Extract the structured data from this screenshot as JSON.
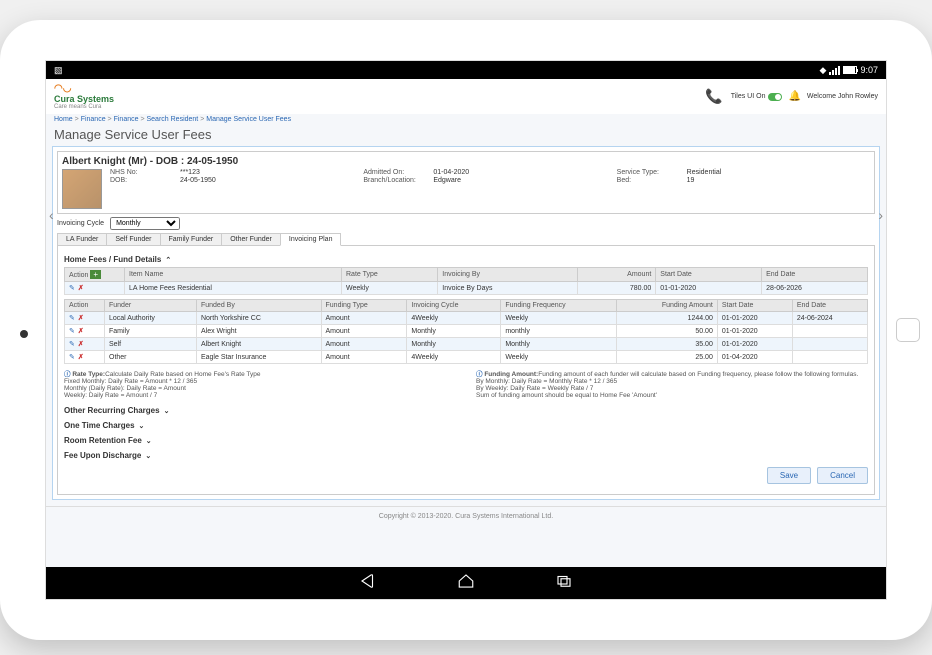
{
  "status_bar": {
    "time": "9:07"
  },
  "logo": {
    "name": "Cura Systems",
    "tagline": "Care means Cura"
  },
  "header": {
    "tiles_label": "Tiles UI On",
    "welcome": "Welcome John Rowley"
  },
  "breadcrumb": [
    "Home",
    "Finance",
    "Finance",
    "Search Resident",
    "Manage Service User Fees"
  ],
  "page_title": "Manage Service User Fees",
  "user": {
    "name_line": "Albert Knight (Mr) - DOB : 24-05-1950",
    "nhs_label": "NHS No:",
    "nhs": "***123",
    "dob_label": "DOB:",
    "dob": "24-05-1950",
    "admitted_label": "Admitted On:",
    "admitted": "01-04-2020",
    "branch_label": "Branch/Location:",
    "branch": "Edgware",
    "svc_label": "Service Type:",
    "svc": "Residential",
    "bed_label": "Bed:",
    "bed": "19"
  },
  "cycle": {
    "label": "Invoicing Cycle",
    "value": "Monthly"
  },
  "tabs": [
    "LA Funder",
    "Self Funder",
    "Family Funder",
    "Other Funder",
    "Invoicing Plan"
  ],
  "section1": "Home Fees / Fund Details",
  "table1": {
    "headers": [
      "Action",
      "Item Name",
      "Rate Type",
      "Invoicing By",
      "Amount",
      "Start Date",
      "End Date"
    ],
    "row": {
      "item": "LA Home Fees Residential",
      "rate": "Weekly",
      "inv_by": "Invoice By Days",
      "amount": "780.00",
      "start": "01-01-2020",
      "end": "28-06-2026"
    }
  },
  "table2": {
    "headers": [
      "Action",
      "Funder",
      "Funded By",
      "Funding Type",
      "Invoicing Cycle",
      "Funding Frequency",
      "Funding Amount",
      "Start Date",
      "End Date"
    ],
    "rows": [
      {
        "funder": "Local Authority",
        "by": "North Yorkshire CC",
        "type": "Amount",
        "cycle": "4Weekly",
        "freq": "Weekly",
        "amt": "1244.00",
        "start": "01-01-2020",
        "end": "24-06-2024"
      },
      {
        "funder": "Family",
        "by": "Alex Wright",
        "type": "Amount",
        "cycle": "Monthly",
        "freq": "monthly",
        "amt": "50.00",
        "start": "01-01-2020",
        "end": ""
      },
      {
        "funder": "Self",
        "by": "Albert Knight",
        "type": "Amount",
        "cycle": "Monthly",
        "freq": "Monthly",
        "amt": "35.00",
        "start": "01-01-2020",
        "end": ""
      },
      {
        "funder": "Other",
        "by": "Eagle Star Insurance",
        "type": "Amount",
        "cycle": "4Weekly",
        "freq": "Weekly",
        "amt": "25.00",
        "start": "01-04-2020",
        "end": ""
      }
    ]
  },
  "note_rate": {
    "title": "Rate Type:",
    "l1": "Calculate Daily Rate based on Home Fee's Rate Type",
    "l2": "Fixed Monthly: Daily Rate = Amount * 12 / 365",
    "l3": "Monthly (Daily Rate): Daily Rate = Amount",
    "l4": "Weekly: Daily Rate = Amount / 7"
  },
  "note_fund": {
    "title": "Funding Amount:",
    "l1": "Funding amount of each funder will calculate based on Funding frequency, please follow the following formulas.",
    "l2": "By Monthly: Daily Rate = Monthly Rate * 12 / 365",
    "l3": "By Weekly: Daily Rate = Weekly Rate / 7",
    "l4": "Sum of funding amount should be equal to Home Fee 'Amount'"
  },
  "sections": {
    "recurring": "Other Recurring Charges",
    "onetime": "One Time Charges",
    "retention": "Room Retention Fee",
    "discharge": "Fee Upon Discharge"
  },
  "buttons": {
    "save": "Save",
    "cancel": "Cancel"
  },
  "footer": "Copyright © 2013-2020. Cura Systems International Ltd."
}
